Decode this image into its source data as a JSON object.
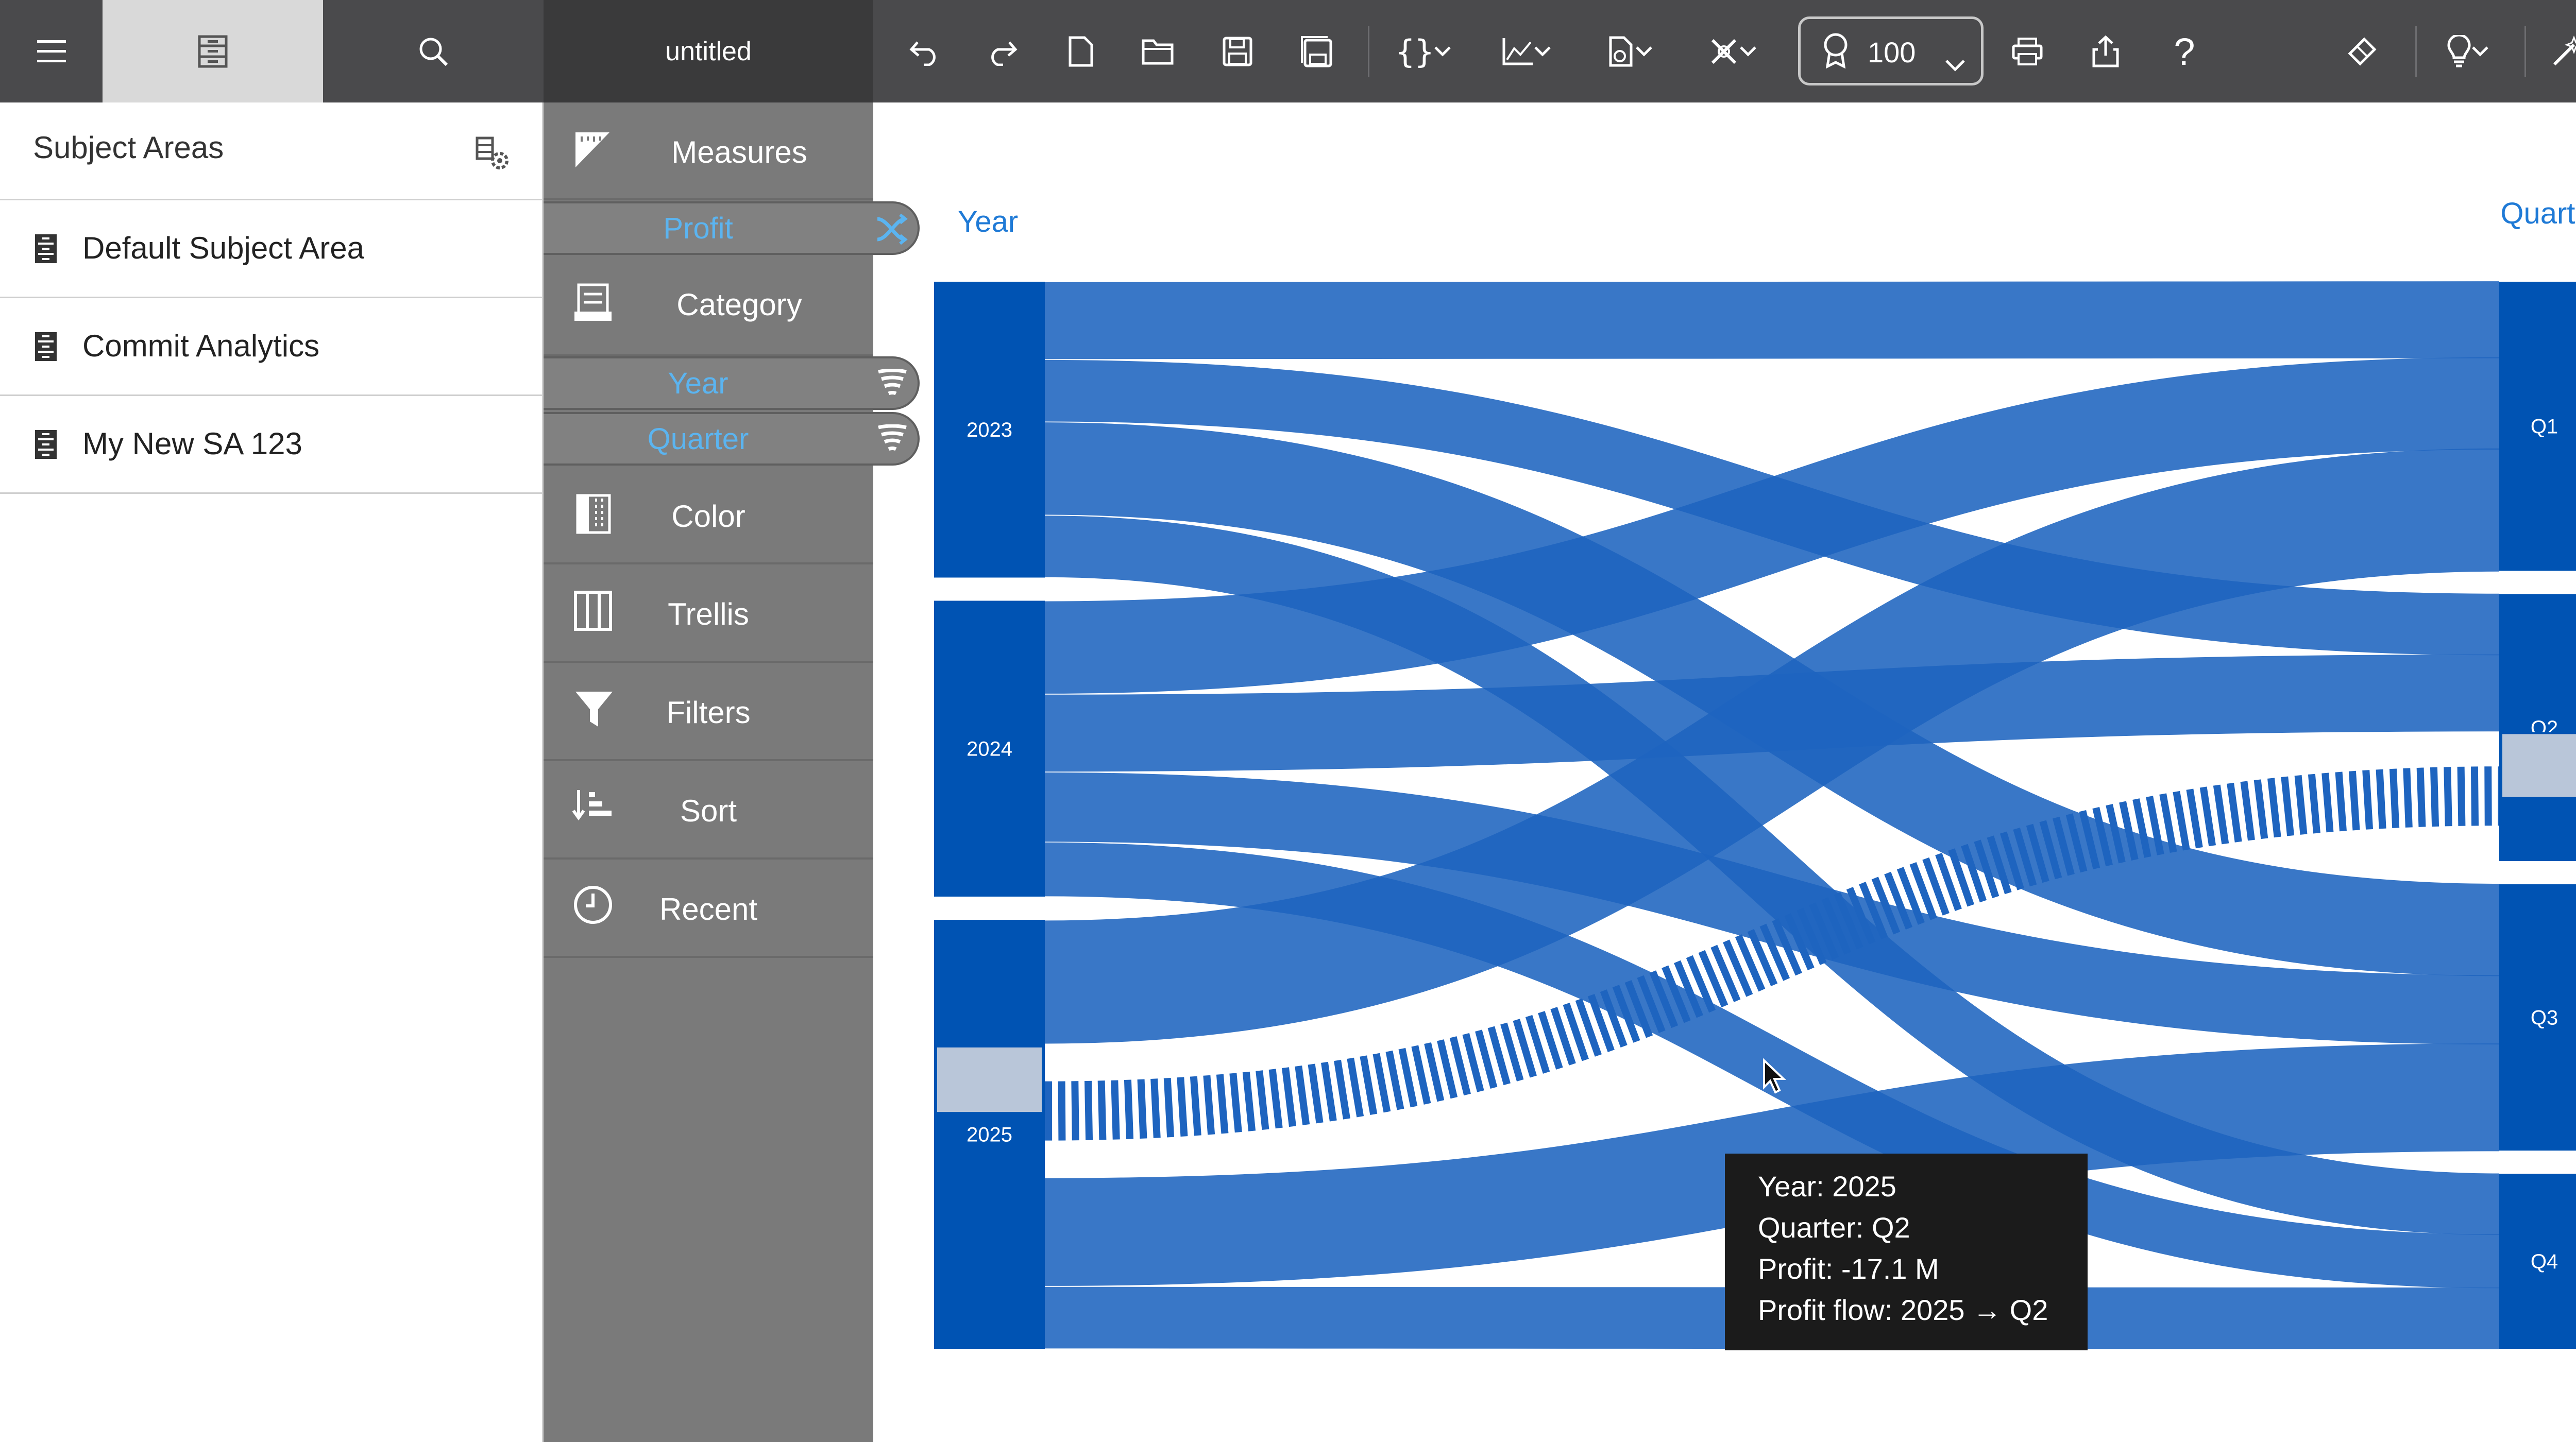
{
  "app": {
    "title": "untitled",
    "zoom": "100"
  },
  "toolbar": {
    "left_icons": [
      "menu-icon",
      "data-panel-icon",
      "search-icon"
    ],
    "actions": [
      "undo-icon",
      "redo-icon",
      "new-icon",
      "open-icon",
      "save-icon",
      "save-as-icon",
      "code-icon",
      "chart-type-icon",
      "export-icon",
      "tools-icon",
      "badge-icon",
      "print-icon",
      "share-icon",
      "help-icon",
      "brush-icon",
      "lightbulb-icon",
      "auto-insight-icon"
    ]
  },
  "subject_areas": {
    "heading": "Subject Areas",
    "items": [
      {
        "label": "Default Subject Area"
      },
      {
        "label": "Commit Analytics"
      },
      {
        "label": "My New SA 123"
      }
    ]
  },
  "grammar": {
    "measures": "Measures",
    "measure_pill": "Profit",
    "category": "Category",
    "category_pills": [
      "Year",
      "Quarter"
    ],
    "color": "Color",
    "trellis": "Trellis",
    "filters": "Filters",
    "sort": "Sort",
    "recent": "Recent"
  },
  "colors": {
    "accent": "#1f7ad6",
    "node": "#0053b3",
    "link": "#1e64bf",
    "highlight": "#b9c6d9",
    "panel_gray": "#7a7a7a"
  },
  "chart_data": {
    "type": "sankey",
    "left_axis_title": "Year",
    "right_axis_title": "Quarter",
    "sources": [
      "2023",
      "2024",
      "2025"
    ],
    "targets": [
      "Q1",
      "Q2",
      "Q3",
      "Q4"
    ],
    "links": [
      {
        "source": "2023",
        "target": "Q1",
        "value": 10
      },
      {
        "source": "2023",
        "target": "Q2",
        "value": 8
      },
      {
        "source": "2023",
        "target": "Q3",
        "value": 12
      },
      {
        "source": "2023",
        "target": "Q4",
        "value": 8
      },
      {
        "source": "2024",
        "target": "Q1",
        "value": 12
      },
      {
        "source": "2024",
        "target": "Q2",
        "value": 10
      },
      {
        "source": "2024",
        "target": "Q3",
        "value": 9
      },
      {
        "source": "2024",
        "target": "Q4",
        "value": 7
      },
      {
        "source": "2025",
        "target": "Q1",
        "value": 16
      },
      {
        "source": "2025",
        "target": "Q2",
        "value": -17.1
      },
      {
        "source": "2025",
        "target": "Q3",
        "value": 14
      },
      {
        "source": "2025",
        "target": "Q4",
        "value": 8
      }
    ],
    "highlighted_link": {
      "source": "2025",
      "target": "Q2"
    }
  },
  "tooltip": {
    "year": "Year: 2025",
    "quarter": "Quarter: Q2",
    "profit": "Profit: -17.1 M",
    "flow": "Profit flow: 2025 → Q2"
  }
}
